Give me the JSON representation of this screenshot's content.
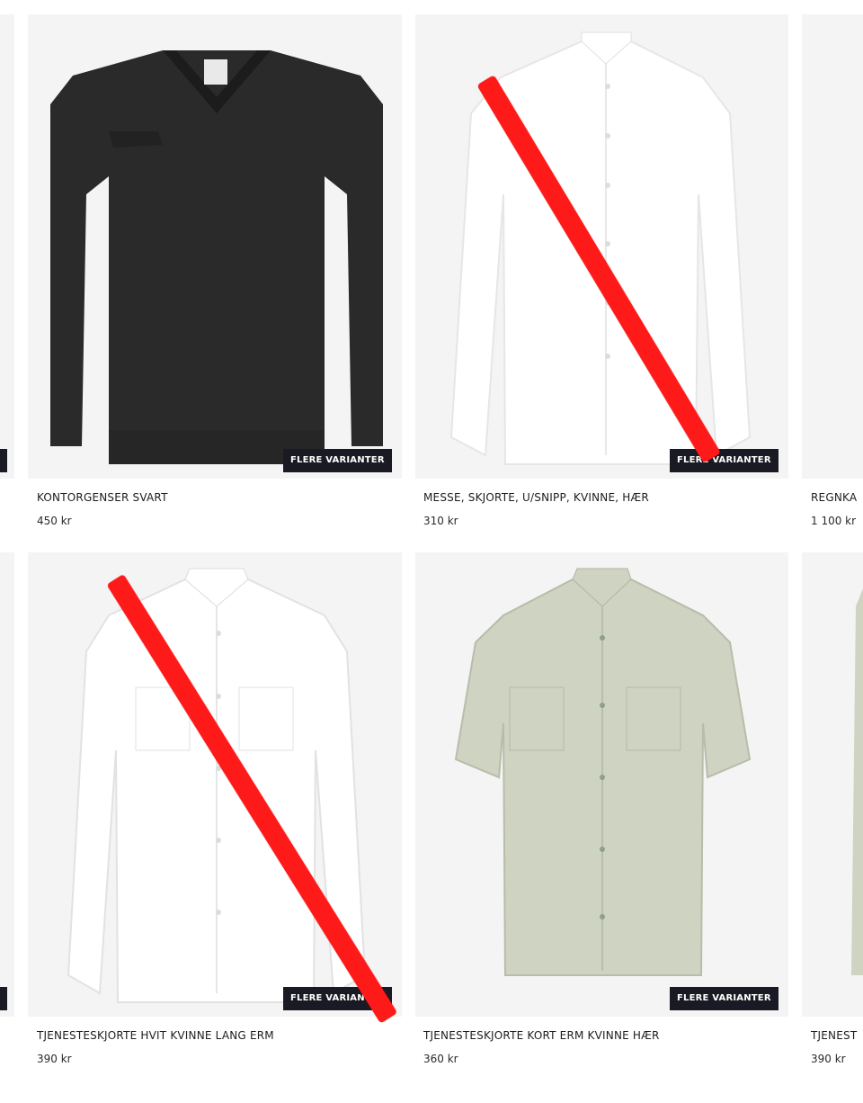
{
  "badge_label": "FLERE VARIANTER",
  "products": [
    {
      "title": "KONTORGENSER SVART",
      "price": "450 kr"
    },
    {
      "title": "MESSE, SKJORTE, U/SNIPP, KVINNE, HÆR",
      "price": "310 kr"
    },
    {
      "title": "REGNKA",
      "price": "1 100 kr"
    },
    {
      "title": "TJENESTESKJORTE HVIT KVINNE LANG ERM",
      "price": "390 kr"
    },
    {
      "title": "TJENESTESKJORTE KORT ERM KVINNE HÆR",
      "price": "360 kr"
    },
    {
      "title": "TJENEST",
      "price": "390 kr"
    }
  ],
  "colors": {
    "badge_bg": "#1a1a24",
    "image_bg": "#f4f4f4",
    "annotation_stroke": "#ff1a1a"
  }
}
